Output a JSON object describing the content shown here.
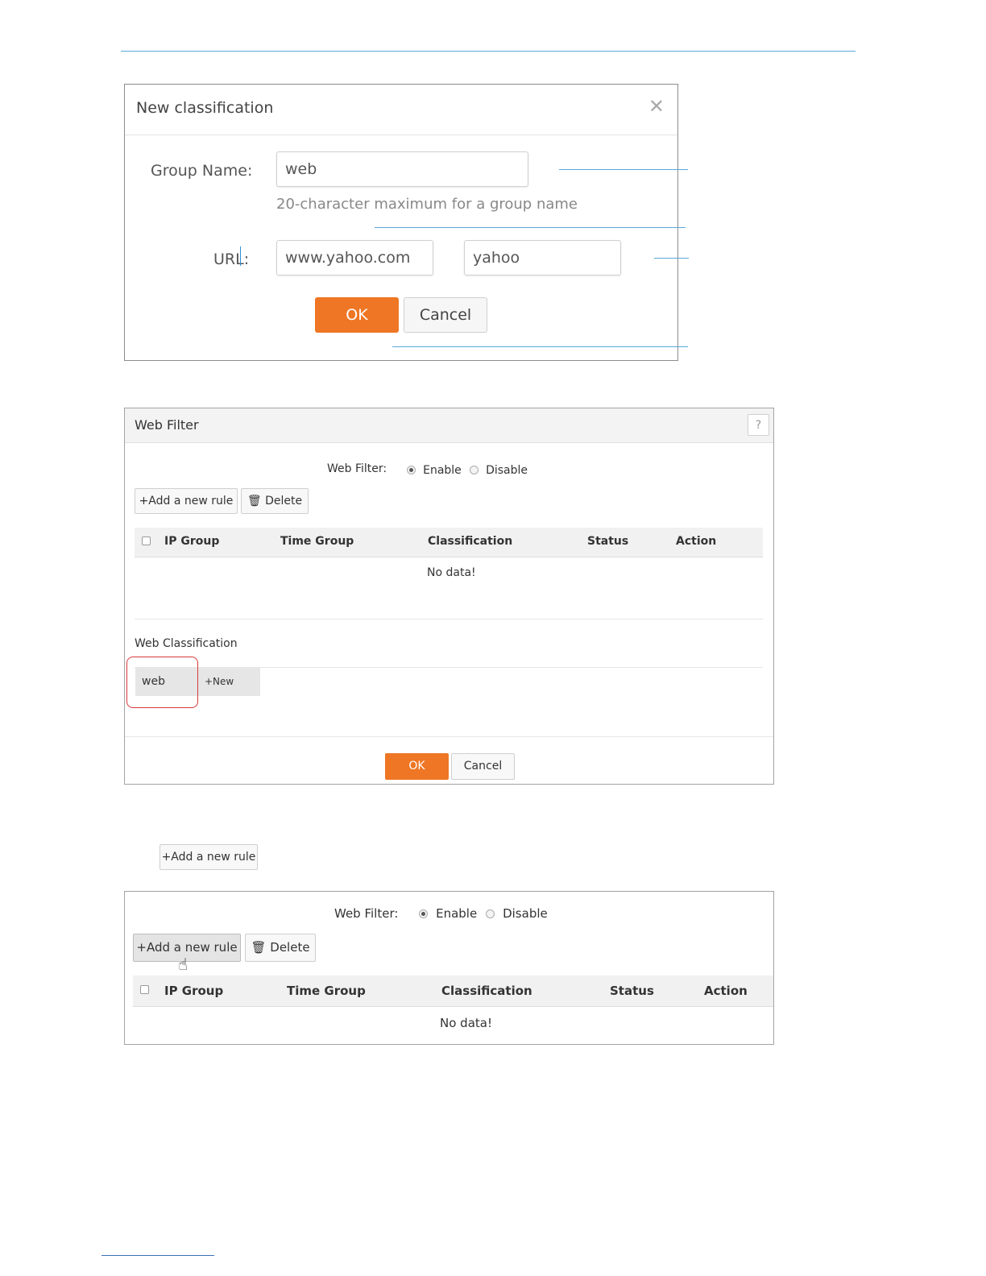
{
  "dialog": {
    "title": "New classification",
    "close_icon": "close-icon",
    "group_name_label": "Group Name:",
    "group_name_value": "web",
    "group_name_hint": "20-character maximum for a group name",
    "url_label": "URL:",
    "url_value": "www.yahoo.com",
    "keyword_value": "yahoo",
    "ok_label": "OK",
    "cancel_label": "Cancel"
  },
  "web_filter_panel": {
    "title": "Web Filter",
    "help_label": "?",
    "toggle_label": "Web Filter:",
    "enable_label": "Enable",
    "disable_label": "Disable",
    "selected": "Enable",
    "add_rule_label": "+Add a new rule",
    "delete_label": "Delete",
    "columns": [
      "IP Group",
      "Time Group",
      "Classification",
      "Status",
      "Action"
    ],
    "empty_text": "No data!",
    "classification_title": "Web Classification",
    "classification_items": [
      "web"
    ],
    "new_label": "+New",
    "ok_label": "OK",
    "cancel_label": "Cancel"
  },
  "standalone_button": {
    "label": "+Add a new rule"
  },
  "rules_panel": {
    "toggle_label": "Web Filter:",
    "enable_label": "Enable",
    "disable_label": "Disable",
    "selected": "Enable",
    "add_rule_label": "+Add a new rule",
    "delete_label": "Delete",
    "columns": [
      "IP Group",
      "Time Group",
      "Classification",
      "Status",
      "Action"
    ],
    "empty_text": "No data!"
  },
  "colors": {
    "accent": "#ee7625",
    "callout_line": "#5aa9d6",
    "highlight_ring": "#d83a3a"
  }
}
